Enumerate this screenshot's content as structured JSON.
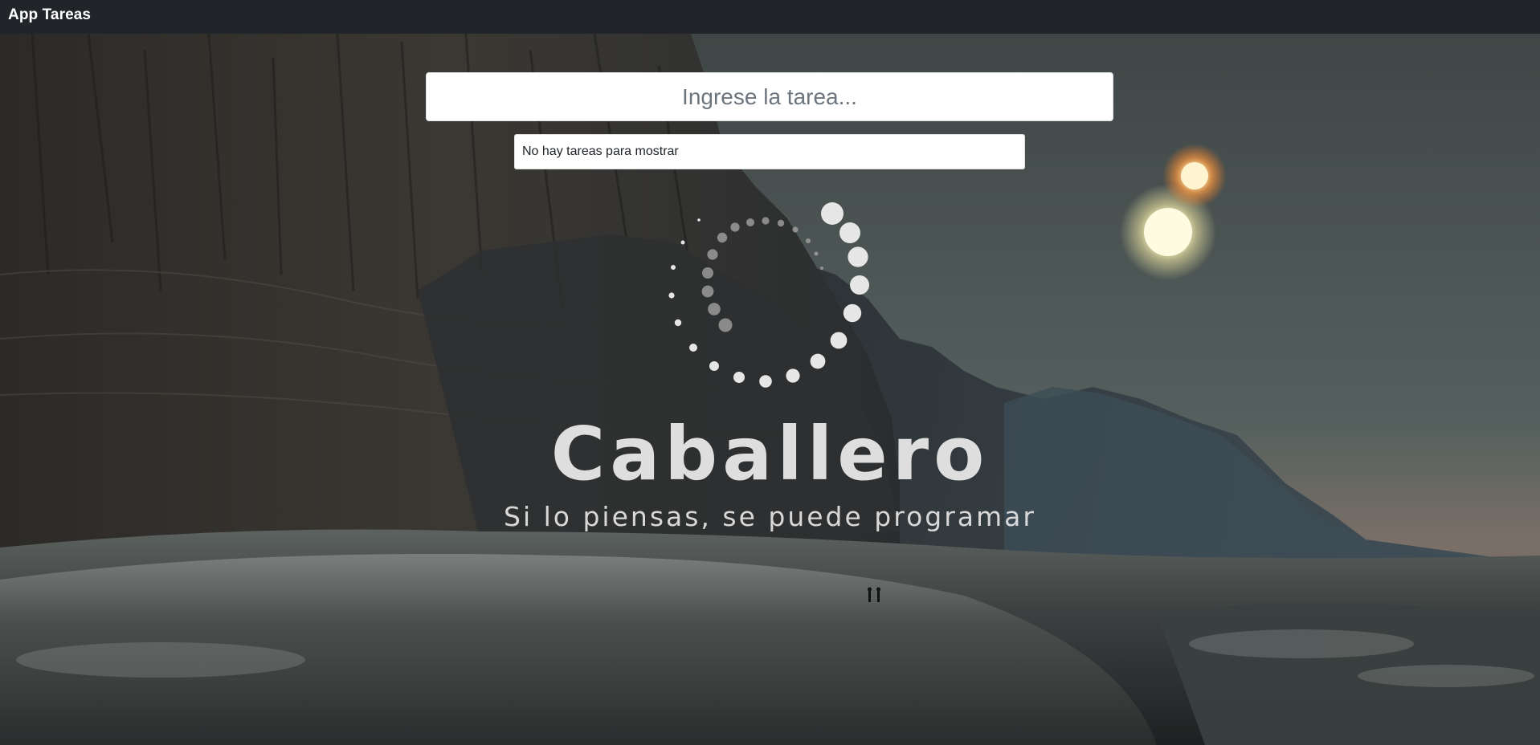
{
  "navbar": {
    "brand": "App Tareas"
  },
  "task_form": {
    "input_placeholder": "Ingrese la tarea...",
    "input_value": ""
  },
  "task_list": {
    "empty_message": "No hay tareas para mostrar"
  },
  "logo": {
    "word": "Caballero",
    "slogan": "Si lo piensas, se puede programar",
    "icon": "dotted-circle-spinner-icon"
  },
  "background": {
    "description_icon": "alien-landscape-background",
    "colors": {
      "navbar": "#212529",
      "sky": "#4a5352",
      "sun": "#fffbe0",
      "logo_text": "#dedede"
    }
  }
}
